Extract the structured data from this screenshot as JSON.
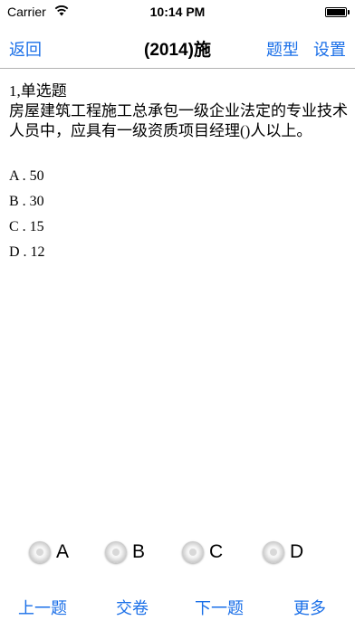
{
  "status_bar": {
    "carrier": "Carrier",
    "time": "10:14 PM",
    "wifi_icon": "wifi-icon",
    "battery_icon": "battery-full-icon"
  },
  "nav": {
    "back_label": "返回",
    "title": "(2014)施",
    "type_label": "题型",
    "settings_label": "设置"
  },
  "question": {
    "header": "1,单选题",
    "text": "房屋建筑工程施工总承包一级企业法定的专业技术人员中，应具有一级资质项目经理()人以上。",
    "options": [
      "A . 50",
      "B . 30",
      "C . 15",
      "D . 12"
    ]
  },
  "answers": {
    "a_label": "A",
    "b_label": "B",
    "c_label": "C",
    "d_label": "D"
  },
  "toolbar": {
    "prev_label": "上一题",
    "submit_label": "交卷",
    "next_label": "下一题",
    "more_label": "更多"
  },
  "colors": {
    "accent": "#1a6fe8",
    "separator": "#b2b2b2"
  }
}
